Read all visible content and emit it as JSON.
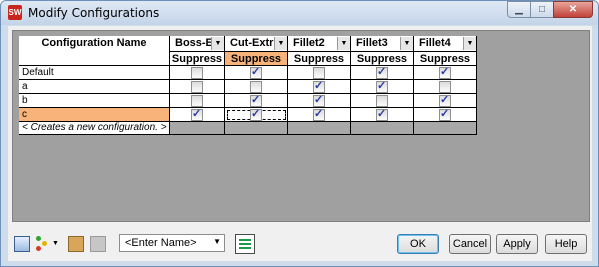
{
  "window": {
    "title": "Modify Configurations",
    "app_icon": "SW"
  },
  "grid": {
    "name_header": "Configuration Name",
    "columns": [
      {
        "name": "Boss-E",
        "param": "Suppress"
      },
      {
        "name": "Cut-Extr",
        "param": "Suppress"
      },
      {
        "name": "Fillet2",
        "param": "Suppress"
      },
      {
        "name": "Fillet3",
        "param": "Suppress"
      },
      {
        "name": "Fillet4",
        "param": "Suppress"
      }
    ],
    "rows": [
      {
        "name": "Default",
        "values": [
          false,
          true,
          false,
          true,
          true
        ]
      },
      {
        "name": "a",
        "values": [
          false,
          false,
          true,
          true,
          false
        ]
      },
      {
        "name": "b",
        "values": [
          false,
          true,
          true,
          false,
          true
        ]
      },
      {
        "name": "c",
        "values": [
          true,
          true,
          true,
          true,
          true
        ]
      }
    ],
    "new_row_label": "< Creates a new configuration. >",
    "selected_row": "c",
    "selected_column": "Cut-Extr",
    "highlight_color": "#f7b37a"
  },
  "toolbar": {
    "name_combo": {
      "value": "<Enter Name>"
    },
    "buttons": {
      "ok": "OK",
      "cancel": "Cancel",
      "apply": "Apply",
      "help": "Help"
    }
  }
}
